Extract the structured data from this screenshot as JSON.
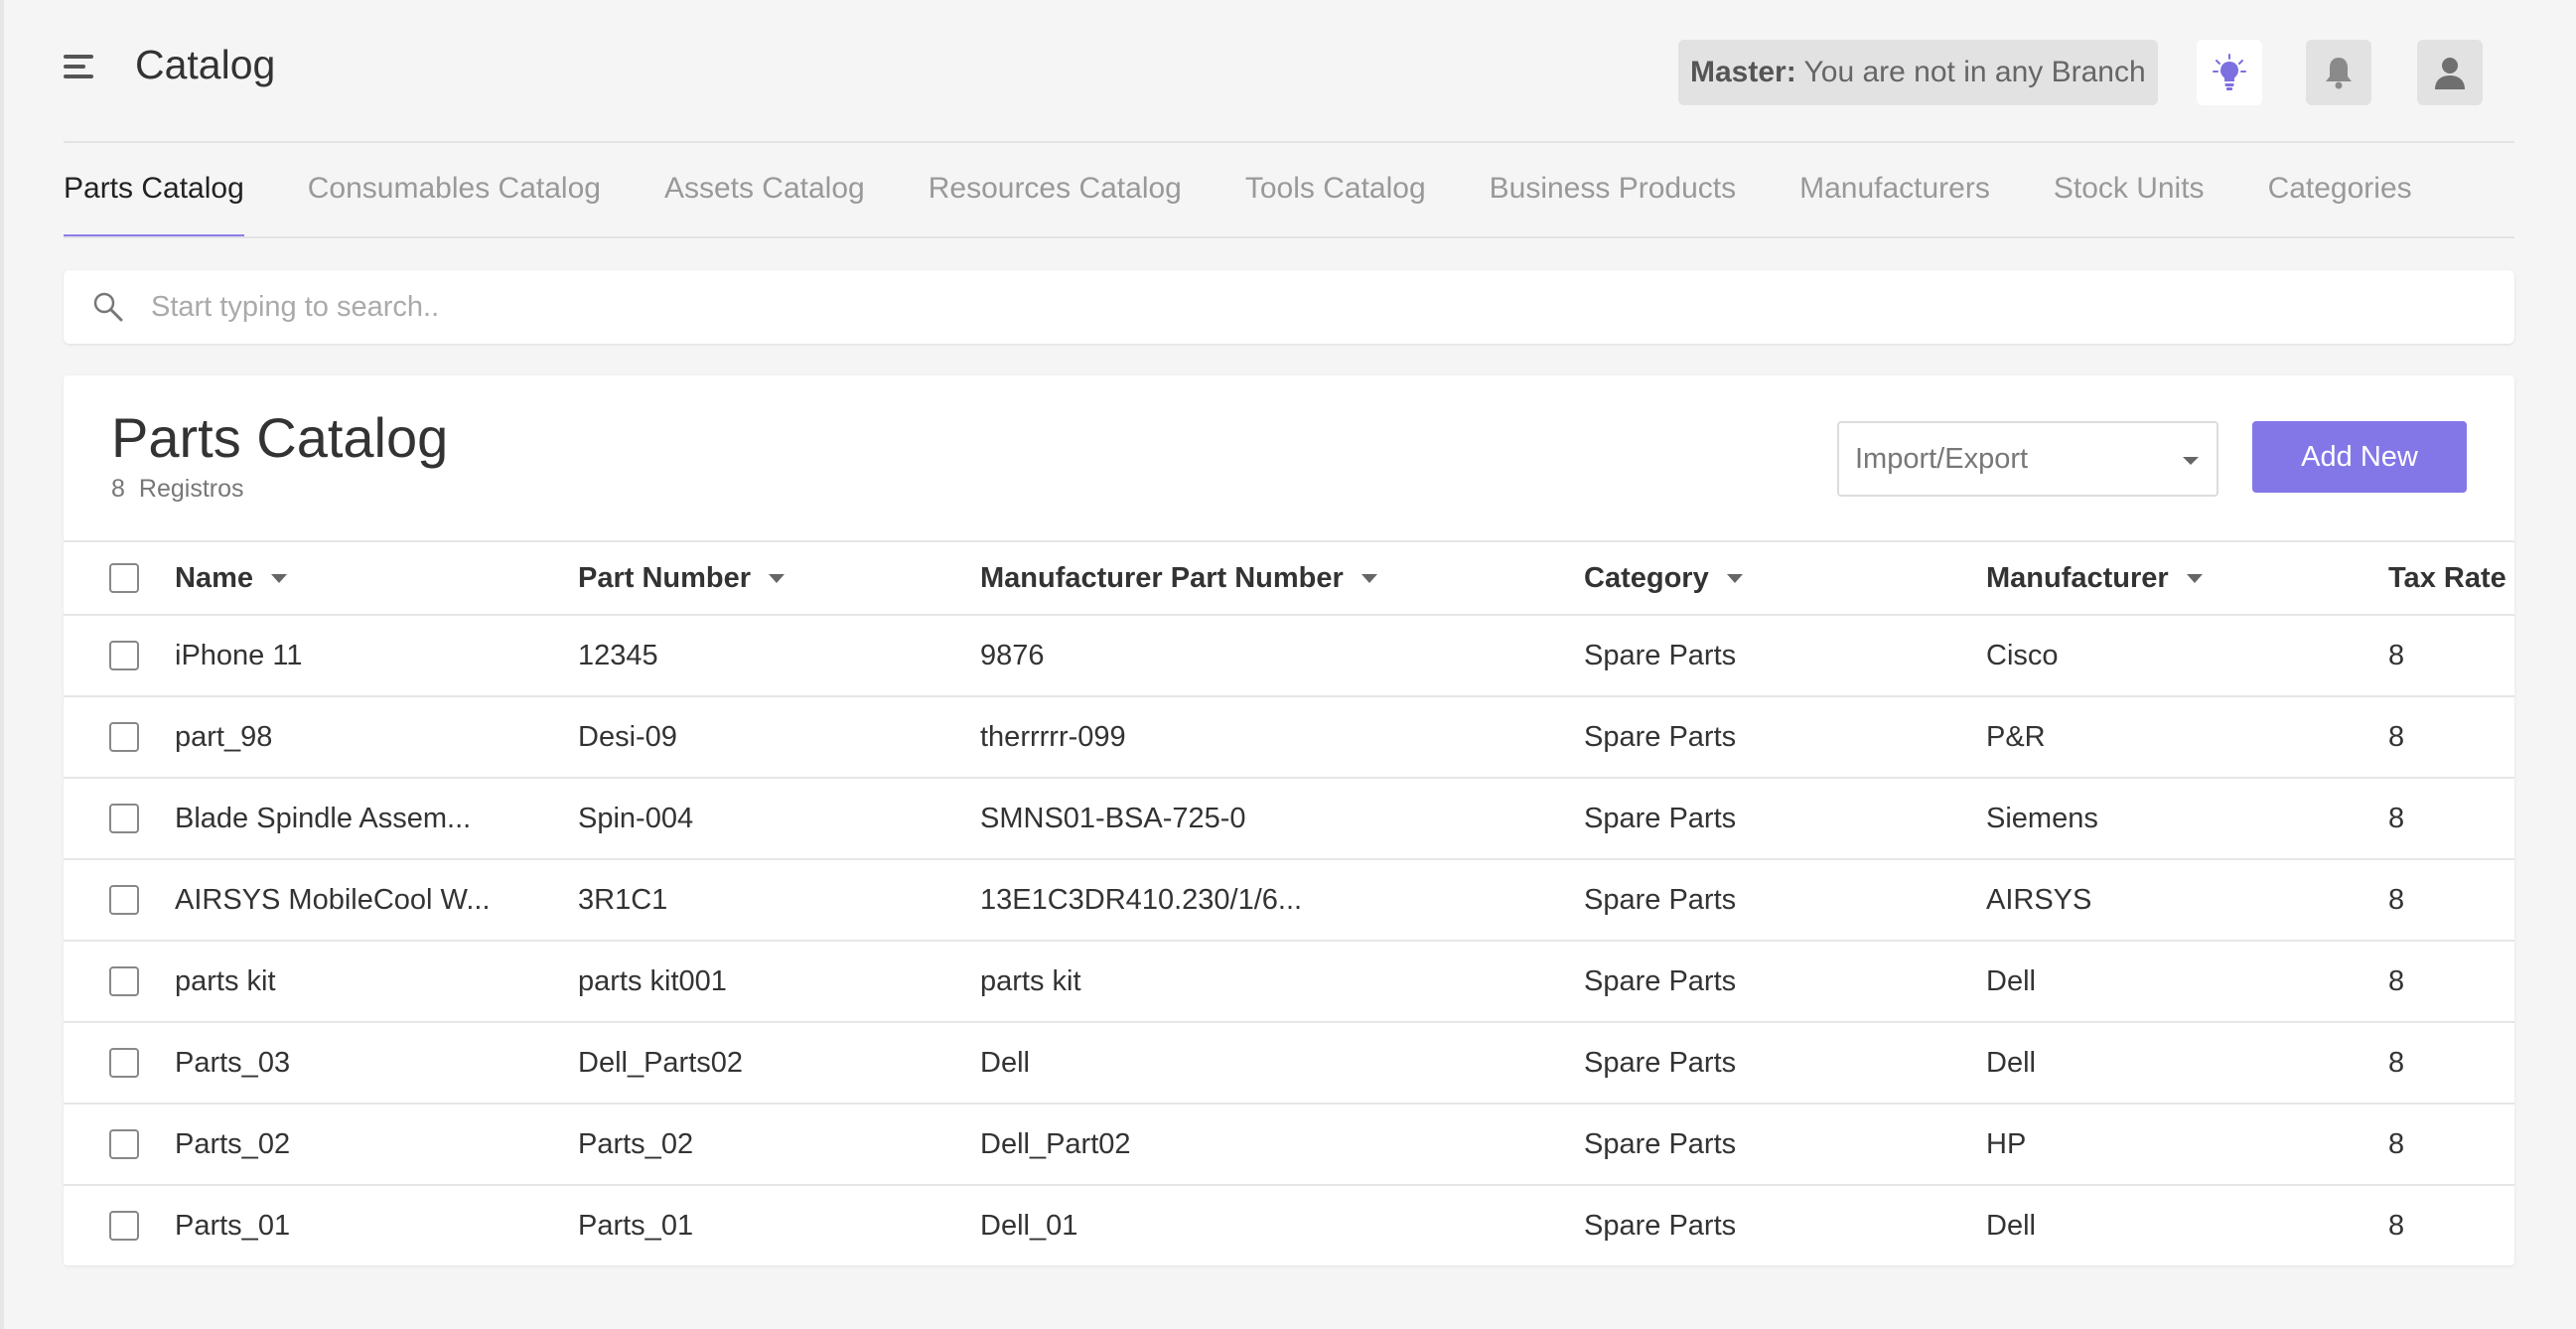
{
  "header": {
    "title": "Catalog",
    "branch_label": "Master:",
    "branch_text": "You are not in any Branch",
    "icons": [
      "menu-icon",
      "lightbulb-icon",
      "bell-icon",
      "user-icon"
    ]
  },
  "tabs": [
    {
      "label": "Parts Catalog",
      "active": true
    },
    {
      "label": "Consumables Catalog"
    },
    {
      "label": "Assets Catalog"
    },
    {
      "label": "Resources Catalog"
    },
    {
      "label": "Tools Catalog"
    },
    {
      "label": "Business Products"
    },
    {
      "label": "Manufacturers"
    },
    {
      "label": "Stock Units"
    },
    {
      "label": "Categories"
    }
  ],
  "search": {
    "placeholder": "Start typing to search.."
  },
  "card": {
    "title": "Parts Catalog",
    "count": "8",
    "count_label": "Registros",
    "import_export": "Import/Export",
    "add_new": "Add New"
  },
  "table": {
    "columns": [
      "Name",
      "Part Number",
      "Manufacturer Part Number",
      "Category",
      "Manufacturer",
      "Tax Rate ("
    ],
    "rows": [
      [
        "iPhone 11",
        "12345",
        "9876",
        "Spare Parts",
        "Cisco",
        "8"
      ],
      [
        "part_98",
        "Desi-09",
        "therrrrr-099",
        "Spare Parts",
        "P&R",
        "8"
      ],
      [
        "Blade Spindle Assem...",
        "Spin-004",
        "SMNS01-BSA-725-0",
        "Spare Parts",
        "Siemens",
        "8"
      ],
      [
        "AIRSYS MobileCool W...",
        "3R1C1",
        "13E1C3DR410.230/1/6...",
        "Spare Parts",
        "AIRSYS",
        "8"
      ],
      [
        "parts kit",
        "parts kit001",
        "parts kit",
        "Spare Parts",
        "Dell",
        "8"
      ],
      [
        "Parts_03",
        "Dell_Parts02",
        "Dell",
        "Spare Parts",
        "Dell",
        "8"
      ],
      [
        "Parts_02",
        "Parts_02",
        "Dell_Part02",
        "Spare Parts",
        "HP",
        "8"
      ],
      [
        "Parts_01",
        "Parts_01",
        "Dell_01",
        "Spare Parts",
        "Dell",
        "8"
      ]
    ]
  },
  "colors": {
    "accent": "#8377e8",
    "tab_underline": "#8b7de8"
  }
}
